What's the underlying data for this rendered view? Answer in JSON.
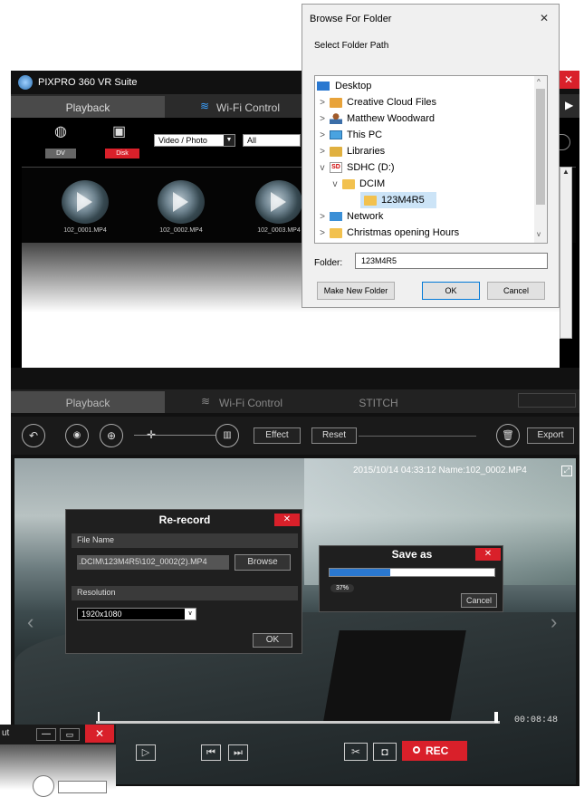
{
  "app1": {
    "title": "PIXPRO 360 VR Suite",
    "tabs": [
      "Playback",
      "Wi-Fi Control"
    ],
    "device_dv": "DV",
    "device_disk": "Disk",
    "filter_type": "Video / Photo",
    "filter_all": "All",
    "files": [
      "102_0001.MP4",
      "102_0002.MP4",
      "102_0003.MP4"
    ]
  },
  "browse": {
    "title": "Browse For Folder",
    "subtitle": "Select Folder Path",
    "tree": [
      {
        "label": "Desktop",
        "icon": "desktop-icon",
        "level": 0,
        "chev": ""
      },
      {
        "label": "Creative Cloud Files",
        "icon": "folder-cc-icon",
        "level": 1,
        "chev": ">"
      },
      {
        "label": "Matthew Woodward",
        "icon": "user-icon",
        "level": 1,
        "chev": ">"
      },
      {
        "label": "This PC",
        "icon": "pc-icon",
        "level": 1,
        "chev": ">"
      },
      {
        "label": "Libraries",
        "icon": "libraries-icon",
        "level": 1,
        "chev": ">"
      },
      {
        "label": "SDHC (D:)",
        "icon": "sd-card-icon",
        "level": 1,
        "chev": "v"
      },
      {
        "label": "DCIM",
        "icon": "folder-icon",
        "level": 2,
        "chev": "v"
      },
      {
        "label": "123M4R5",
        "icon": "folder-icon",
        "level": 3,
        "chev": ""
      },
      {
        "label": "Network",
        "icon": "network-icon",
        "level": 1,
        "chev": ">"
      },
      {
        "label": "Christmas opening Hours",
        "icon": "folder-icon",
        "level": 1,
        "chev": ">"
      }
    ],
    "folder_label": "Folder:",
    "folder_value": "123M4R5",
    "make_new": "Make New Folder",
    "ok": "OK",
    "cancel": "Cancel",
    "close": "✕"
  },
  "app2": {
    "tabs": [
      "Playback",
      "Wi-Fi Control",
      "STITCH"
    ],
    "effect": "Effect",
    "reset": "Reset",
    "export": "Export",
    "overlay_text": "2015/10/14 04:33:12 Name:102_0002.MP4",
    "time": "00:08:48",
    "progress_fraction": 0.86,
    "rec": "REC"
  },
  "rerecord": {
    "title": "Re-record",
    "file_name_label": "File Name",
    "path": ".DCIM\\123M4R5\\102_0002(2).MP4",
    "browse": "Browse",
    "resolution_label": "Resolution",
    "resolution": "1920x1080",
    "ok": "OK",
    "close": "✕"
  },
  "saveas": {
    "title": "Save as",
    "progress": 37,
    "progress_text": "37%",
    "cancel": "Cancel",
    "close": "✕"
  },
  "mini": {
    "label": "ut"
  },
  "colors": {
    "accent_red": "#d9202a",
    "progress_blue": "#2a78d0",
    "wifi_blue": "#3aa0ff"
  }
}
